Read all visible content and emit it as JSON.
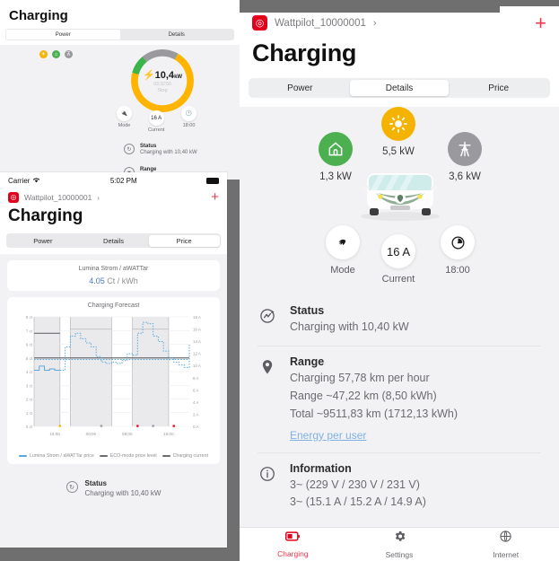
{
  "panel_left_top": {
    "title": "Charging",
    "tabs": [
      {
        "label": "Power",
        "active": true
      },
      {
        "label": "Details",
        "active": false
      }
    ],
    "mini_icons": [
      "sun-icon",
      "house-icon",
      "pylon-icon"
    ],
    "gauge": {
      "power": "10,4",
      "unit": "kW",
      "timer": "03:32:50",
      "action": "Stop"
    },
    "controls": [
      {
        "label": "Mode",
        "value": "",
        "icon": "plug-icon"
      },
      {
        "label": "Current",
        "value": "16 A",
        "icon": ""
      },
      {
        "label": "18:00",
        "value": "",
        "icon": "clock-icon"
      }
    ],
    "rows": [
      {
        "title": "Status",
        "text": "Charging with 10,40 kW",
        "icon": "status-icon"
      },
      {
        "title": "Range",
        "text": "",
        "icon": "pin-icon"
      }
    ]
  },
  "panel_left_bottom": {
    "statusbar": {
      "carrier": "Carrier",
      "wifi": "wifi-icon",
      "time": "5:02 PM",
      "battery": "battery-icon"
    },
    "nav": {
      "device": "Wattpilot_10000001",
      "chevron": "›",
      "add": "+"
    },
    "title": "Charging",
    "tabs": [
      {
        "label": "Power",
        "active": false
      },
      {
        "label": "Details",
        "active": false
      },
      {
        "label": "Price",
        "active": true
      }
    ],
    "price_card": {
      "tariff": "Lumina Strom / aWATTar",
      "value": "4.05",
      "unit": "Ct / kWh"
    },
    "status": {
      "title": "Status",
      "text": "Charging with 10,40 kW"
    }
  },
  "chart_data": {
    "type": "line",
    "title": "Charging Forecast",
    "xlabel": "",
    "ylabel": "ct",
    "y2label": "A",
    "ylim": [
      0,
      8
    ],
    "y2lim": [
      0,
      18
    ],
    "ytick_labels": [
      "8 ct",
      "7 ct",
      "6 ct",
      "5 ct",
      "4 ct",
      "3 ct",
      "2 ct",
      "1 ct",
      "0 ct"
    ],
    "y2tick_labels": [
      "18 A",
      "16 A",
      "14 A",
      "12 A",
      "10 A",
      "8 A",
      "6 A",
      "4 A",
      "2 A",
      "0 A"
    ],
    "xtick_labels": [
      "16:00",
      "00:00",
      "08:00",
      "16:00"
    ],
    "grid": true,
    "legend_position": "bottom",
    "legend": [
      {
        "name": "Lumina Strom / aWATTar price",
        "color": "#5aa9dd",
        "style": "solid"
      },
      {
        "name": "ECO-mode price level",
        "color": "#6b6b70",
        "style": "solid"
      },
      {
        "name": "Charging current",
        "color": "#6b6b70",
        "style": "solid"
      }
    ],
    "eco_level_ct": 5.0,
    "charging_current_a": 11.0,
    "past_price_level_ct": 6.8,
    "night_band_level_ct": 7.1,
    "series": [
      {
        "name": "Lumina Strom / aWATTar price",
        "color": "#5aa9dd",
        "x": [
          "14:00",
          "15:00",
          "16:00",
          "17:00",
          "18:00",
          "19:00",
          "20:00",
          "21:00",
          "22:00",
          "23:00",
          "00:00",
          "01:00",
          "02:00",
          "03:00",
          "04:00",
          "05:00",
          "06:00",
          "07:00",
          "08:00",
          "09:00",
          "10:00",
          "11:00",
          "12:00",
          "13:00",
          "14:00",
          "15:00",
          "16:00",
          "17:00",
          "18:00",
          "19:00",
          "20:00"
        ],
        "values": [
          4.1,
          4.4,
          4.1,
          4.2,
          4.1,
          4.1,
          5.8,
          6.6,
          6.8,
          6.4,
          6.1,
          5.8,
          5.1,
          4.7,
          4.6,
          4.7,
          4.6,
          4.8,
          5.3,
          5.2,
          6.8,
          7.6,
          7.5,
          6.6,
          6.2,
          5.5,
          5.0,
          4.7,
          4.5,
          4.3,
          6.0
        ]
      }
    ],
    "shaded_bands": [
      {
        "from": "14:00",
        "to": "19:00",
        "level_ct": 6.8
      },
      {
        "from": "21:00",
        "to": "05:00",
        "level_ct": 7.1
      },
      {
        "from": "09:00",
        "to": "16:00",
        "level_ct": 7.1
      }
    ]
  },
  "panel_right": {
    "nav": {
      "device": "Wattpilot_10000001",
      "chevron": "›",
      "add": "+"
    },
    "title": "Charging",
    "tabs": [
      {
        "label": "Power",
        "active": false
      },
      {
        "label": "Details",
        "active": true
      },
      {
        "label": "Price",
        "active": false
      }
    ],
    "flow": {
      "house": {
        "value": "1,3 kW",
        "icon": "house-icon",
        "color": "#4caf50"
      },
      "sun": {
        "value": "5,5 kW",
        "icon": "sun-icon",
        "color": "#f5b301"
      },
      "grid": {
        "value": "3,6 kW",
        "icon": "pylon-icon",
        "color": "#9a9a9e"
      },
      "vehicle": "car-illustration"
    },
    "controls": [
      {
        "label": "Mode",
        "value": "",
        "icon": "plug-icon"
      },
      {
        "label": "Current",
        "value": "16 A",
        "icon": ""
      },
      {
        "label": "18:00",
        "value": "",
        "icon": "clock-icon"
      }
    ],
    "sections": [
      {
        "icon": "status-icon",
        "title": "Status",
        "lines": [
          "Charging with 10,40 kW"
        ],
        "link": ""
      },
      {
        "icon": "pin-icon",
        "title": "Range",
        "lines": [
          "Charging 57,78 km per hour",
          "Range ~47,22 km (8,50 kWh)",
          "Total ~9511,83 km (1712,13 kWh)"
        ],
        "link": "Energy per user"
      },
      {
        "icon": "info-icon",
        "title": "Information",
        "lines": [
          "3~ (229 V / 230 V / 231 V)",
          "3~ (15.1 A / 15.2 A / 14.9 A)"
        ],
        "link": ""
      }
    ],
    "tabbar": [
      {
        "label": "Charging",
        "icon": "battery-charging-icon",
        "active": true
      },
      {
        "label": "Settings",
        "icon": "gear-icon",
        "active": false
      },
      {
        "label": "Internet",
        "icon": "globe-icon",
        "active": false
      }
    ]
  }
}
